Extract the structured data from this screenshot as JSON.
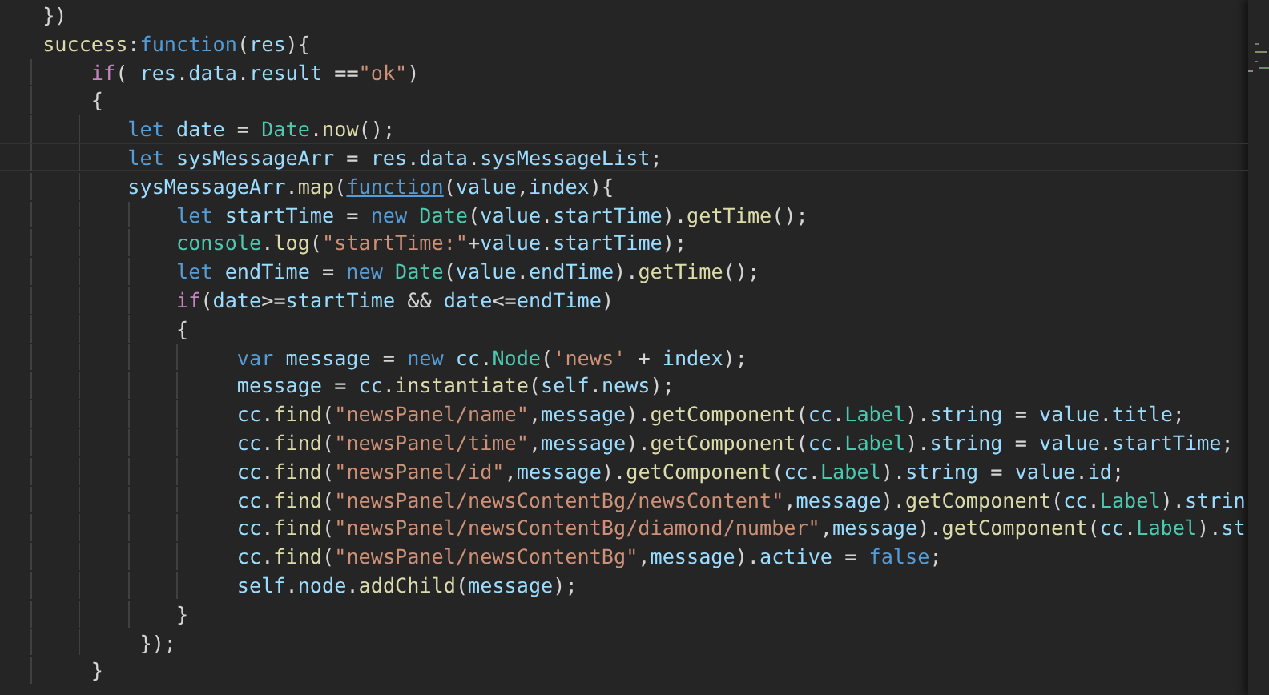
{
  "editor": {
    "lines": [
      {
        "current": false,
        "tokens": [
          {
            "t": "})",
            "kind": "p"
          }
        ]
      },
      {
        "current": false,
        "tokens": [
          {
            "t": "success",
            "kind": "fn"
          },
          {
            "t": ":",
            "kind": "p"
          },
          {
            "t": "function",
            "kind": "kw"
          },
          {
            "t": "(",
            "kind": "p"
          },
          {
            "t": "res",
            "kind": "v"
          },
          {
            "t": "){",
            "kind": "p"
          }
        ]
      },
      {
        "current": false,
        "tokens": [
          {
            "t": "    if",
            "kind": "ctl"
          },
          {
            "t": "( ",
            "kind": "p"
          },
          {
            "t": "res",
            "kind": "v"
          },
          {
            "t": ".",
            "kind": "p"
          },
          {
            "t": "data",
            "kind": "v"
          },
          {
            "t": ".",
            "kind": "p"
          },
          {
            "t": "result",
            "kind": "v"
          },
          {
            "t": " ==",
            "kind": "p"
          },
          {
            "t": "\"ok\"",
            "kind": "str"
          },
          {
            "t": ")",
            "kind": "p"
          }
        ]
      },
      {
        "current": false,
        "tokens": [
          {
            "t": "    {",
            "kind": "p"
          }
        ]
      },
      {
        "current": false,
        "tokens": [
          {
            "t": "       let ",
            "kind": "kw"
          },
          {
            "t": "date",
            "kind": "v"
          },
          {
            "t": " = ",
            "kind": "p"
          },
          {
            "t": "Date",
            "kind": "cls"
          },
          {
            "t": ".",
            "kind": "p"
          },
          {
            "t": "now",
            "kind": "fn"
          },
          {
            "t": "();",
            "kind": "p"
          }
        ]
      },
      {
        "current": true,
        "tokens": [
          {
            "t": "       let ",
            "kind": "kw"
          },
          {
            "t": "sysMessageArr",
            "kind": "v"
          },
          {
            "t": " = ",
            "kind": "p"
          },
          {
            "t": "res",
            "kind": "v"
          },
          {
            "t": ".",
            "kind": "p"
          },
          {
            "t": "data",
            "kind": "v"
          },
          {
            "t": ".",
            "kind": "p"
          },
          {
            "t": "sysMessageList",
            "kind": "v"
          },
          {
            "t": ";",
            "kind": "p"
          }
        ]
      },
      {
        "current": false,
        "tokens": [
          {
            "t": "       sysMessageArr",
            "kind": "v"
          },
          {
            "t": ".",
            "kind": "p"
          },
          {
            "t": "map",
            "kind": "fn"
          },
          {
            "t": "(",
            "kind": "p"
          },
          {
            "t": "function",
            "kind": "link"
          },
          {
            "t": "(",
            "kind": "p"
          },
          {
            "t": "value",
            "kind": "v"
          },
          {
            "t": ",",
            "kind": "p"
          },
          {
            "t": "index",
            "kind": "v"
          },
          {
            "t": "){",
            "kind": "p"
          }
        ]
      },
      {
        "current": false,
        "tokens": [
          {
            "t": "           let ",
            "kind": "kw"
          },
          {
            "t": "startTime",
            "kind": "v"
          },
          {
            "t": " = ",
            "kind": "p"
          },
          {
            "t": "new ",
            "kind": "kw"
          },
          {
            "t": "Date",
            "kind": "cls"
          },
          {
            "t": "(",
            "kind": "p"
          },
          {
            "t": "value",
            "kind": "v"
          },
          {
            "t": ".",
            "kind": "p"
          },
          {
            "t": "startTime",
            "kind": "v"
          },
          {
            "t": ").",
            "kind": "p"
          },
          {
            "t": "getTime",
            "kind": "fn"
          },
          {
            "t": "();",
            "kind": "p"
          }
        ]
      },
      {
        "current": false,
        "tokens": [
          {
            "t": "           console",
            "kind": "cls"
          },
          {
            "t": ".",
            "kind": "p"
          },
          {
            "t": "log",
            "kind": "fn"
          },
          {
            "t": "(",
            "kind": "p"
          },
          {
            "t": "\"startTime:\"",
            "kind": "str"
          },
          {
            "t": "+",
            "kind": "p"
          },
          {
            "t": "value",
            "kind": "v"
          },
          {
            "t": ".",
            "kind": "p"
          },
          {
            "t": "startTime",
            "kind": "v"
          },
          {
            "t": ");",
            "kind": "p"
          }
        ]
      },
      {
        "current": false,
        "tokens": [
          {
            "t": "           let ",
            "kind": "kw"
          },
          {
            "t": "endTime",
            "kind": "v"
          },
          {
            "t": " = ",
            "kind": "p"
          },
          {
            "t": "new ",
            "kind": "kw"
          },
          {
            "t": "Date",
            "kind": "cls"
          },
          {
            "t": "(",
            "kind": "p"
          },
          {
            "t": "value",
            "kind": "v"
          },
          {
            "t": ".",
            "kind": "p"
          },
          {
            "t": "endTime",
            "kind": "v"
          },
          {
            "t": ").",
            "kind": "p"
          },
          {
            "t": "getTime",
            "kind": "fn"
          },
          {
            "t": "();",
            "kind": "p"
          }
        ]
      },
      {
        "current": false,
        "tokens": [
          {
            "t": "           if",
            "kind": "ctl"
          },
          {
            "t": "(",
            "kind": "p"
          },
          {
            "t": "date",
            "kind": "v"
          },
          {
            "t": ">=",
            "kind": "p"
          },
          {
            "t": "startTime",
            "kind": "v"
          },
          {
            "t": " && ",
            "kind": "p"
          },
          {
            "t": "date",
            "kind": "v"
          },
          {
            "t": "<=",
            "kind": "p"
          },
          {
            "t": "endTime",
            "kind": "v"
          },
          {
            "t": ")",
            "kind": "p"
          }
        ]
      },
      {
        "current": false,
        "tokens": [
          {
            "t": "           {",
            "kind": "p"
          }
        ]
      },
      {
        "current": false,
        "tokens": [
          {
            "t": "                var ",
            "kind": "kw"
          },
          {
            "t": "message",
            "kind": "v"
          },
          {
            "t": " = ",
            "kind": "p"
          },
          {
            "t": "new ",
            "kind": "kw"
          },
          {
            "t": "cc",
            "kind": "v"
          },
          {
            "t": ".",
            "kind": "p"
          },
          {
            "t": "Node",
            "kind": "cls"
          },
          {
            "t": "(",
            "kind": "p"
          },
          {
            "t": "'news'",
            "kind": "str"
          },
          {
            "t": " + ",
            "kind": "p"
          },
          {
            "t": "index",
            "kind": "v"
          },
          {
            "t": ");",
            "kind": "p"
          }
        ]
      },
      {
        "current": false,
        "tokens": [
          {
            "t": "                message",
            "kind": "v"
          },
          {
            "t": " = ",
            "kind": "p"
          },
          {
            "t": "cc",
            "kind": "v"
          },
          {
            "t": ".",
            "kind": "p"
          },
          {
            "t": "instantiate",
            "kind": "fn"
          },
          {
            "t": "(",
            "kind": "p"
          },
          {
            "t": "self",
            "kind": "v"
          },
          {
            "t": ".",
            "kind": "p"
          },
          {
            "t": "news",
            "kind": "v"
          },
          {
            "t": ");",
            "kind": "p"
          }
        ]
      },
      {
        "current": false,
        "tokens": [
          {
            "t": "                cc",
            "kind": "v"
          },
          {
            "t": ".",
            "kind": "p"
          },
          {
            "t": "find",
            "kind": "fn"
          },
          {
            "t": "(",
            "kind": "p"
          },
          {
            "t": "\"newsPanel/name\"",
            "kind": "str"
          },
          {
            "t": ",",
            "kind": "p"
          },
          {
            "t": "message",
            "kind": "v"
          },
          {
            "t": ").",
            "kind": "p"
          },
          {
            "t": "getComponent",
            "kind": "fn"
          },
          {
            "t": "(",
            "kind": "p"
          },
          {
            "t": "cc",
            "kind": "v"
          },
          {
            "t": ".",
            "kind": "p"
          },
          {
            "t": "Label",
            "kind": "cls"
          },
          {
            "t": ").",
            "kind": "p"
          },
          {
            "t": "string",
            "kind": "v"
          },
          {
            "t": " = ",
            "kind": "p"
          },
          {
            "t": "value",
            "kind": "v"
          },
          {
            "t": ".",
            "kind": "p"
          },
          {
            "t": "title",
            "kind": "v"
          },
          {
            "t": ";",
            "kind": "p"
          }
        ]
      },
      {
        "current": false,
        "tokens": [
          {
            "t": "                cc",
            "kind": "v"
          },
          {
            "t": ".",
            "kind": "p"
          },
          {
            "t": "find",
            "kind": "fn"
          },
          {
            "t": "(",
            "kind": "p"
          },
          {
            "t": "\"newsPanel/time\"",
            "kind": "str"
          },
          {
            "t": ",",
            "kind": "p"
          },
          {
            "t": "message",
            "kind": "v"
          },
          {
            "t": ").",
            "kind": "p"
          },
          {
            "t": "getComponent",
            "kind": "fn"
          },
          {
            "t": "(",
            "kind": "p"
          },
          {
            "t": "cc",
            "kind": "v"
          },
          {
            "t": ".",
            "kind": "p"
          },
          {
            "t": "Label",
            "kind": "cls"
          },
          {
            "t": ").",
            "kind": "p"
          },
          {
            "t": "string",
            "kind": "v"
          },
          {
            "t": " = ",
            "kind": "p"
          },
          {
            "t": "value",
            "kind": "v"
          },
          {
            "t": ".",
            "kind": "p"
          },
          {
            "t": "startTime",
            "kind": "v"
          },
          {
            "t": ";",
            "kind": "p"
          }
        ]
      },
      {
        "current": false,
        "tokens": [
          {
            "t": "                cc",
            "kind": "v"
          },
          {
            "t": ".",
            "kind": "p"
          },
          {
            "t": "find",
            "kind": "fn"
          },
          {
            "t": "(",
            "kind": "p"
          },
          {
            "t": "\"newsPanel/id\"",
            "kind": "str"
          },
          {
            "t": ",",
            "kind": "p"
          },
          {
            "t": "message",
            "kind": "v"
          },
          {
            "t": ").",
            "kind": "p"
          },
          {
            "t": "getComponent",
            "kind": "fn"
          },
          {
            "t": "(",
            "kind": "p"
          },
          {
            "t": "cc",
            "kind": "v"
          },
          {
            "t": ".",
            "kind": "p"
          },
          {
            "t": "Label",
            "kind": "cls"
          },
          {
            "t": ").",
            "kind": "p"
          },
          {
            "t": "string",
            "kind": "v"
          },
          {
            "t": " = ",
            "kind": "p"
          },
          {
            "t": "value",
            "kind": "v"
          },
          {
            "t": ".",
            "kind": "p"
          },
          {
            "t": "id",
            "kind": "v"
          },
          {
            "t": ";",
            "kind": "p"
          }
        ]
      },
      {
        "current": false,
        "tokens": [
          {
            "t": "                cc",
            "kind": "v"
          },
          {
            "t": ".",
            "kind": "p"
          },
          {
            "t": "find",
            "kind": "fn"
          },
          {
            "t": "(",
            "kind": "p"
          },
          {
            "t": "\"newsPanel/newsContentBg/newsContent\"",
            "kind": "str"
          },
          {
            "t": ",",
            "kind": "p"
          },
          {
            "t": "message",
            "kind": "v"
          },
          {
            "t": ").",
            "kind": "p"
          },
          {
            "t": "getComponent",
            "kind": "fn"
          },
          {
            "t": "(",
            "kind": "p"
          },
          {
            "t": "cc",
            "kind": "v"
          },
          {
            "t": ".",
            "kind": "p"
          },
          {
            "t": "Label",
            "kind": "cls"
          },
          {
            "t": ").",
            "kind": "p"
          },
          {
            "t": "strin",
            "kind": "v"
          }
        ]
      },
      {
        "current": false,
        "tokens": [
          {
            "t": "                cc",
            "kind": "v"
          },
          {
            "t": ".",
            "kind": "p"
          },
          {
            "t": "find",
            "kind": "fn"
          },
          {
            "t": "(",
            "kind": "p"
          },
          {
            "t": "\"newsPanel/newsContentBg/diamond/number\"",
            "kind": "str"
          },
          {
            "t": ",",
            "kind": "p"
          },
          {
            "t": "message",
            "kind": "v"
          },
          {
            "t": ").",
            "kind": "p"
          },
          {
            "t": "getComponent",
            "kind": "fn"
          },
          {
            "t": "(",
            "kind": "p"
          },
          {
            "t": "cc",
            "kind": "v"
          },
          {
            "t": ".",
            "kind": "p"
          },
          {
            "t": "Label",
            "kind": "cls"
          },
          {
            "t": ").",
            "kind": "p"
          },
          {
            "t": "st",
            "kind": "v"
          }
        ]
      },
      {
        "current": false,
        "tokens": [
          {
            "t": "                cc",
            "kind": "v"
          },
          {
            "t": ".",
            "kind": "p"
          },
          {
            "t": "find",
            "kind": "fn"
          },
          {
            "t": "(",
            "kind": "p"
          },
          {
            "t": "\"newsPanel/newsContentBg\"",
            "kind": "str"
          },
          {
            "t": ",",
            "kind": "p"
          },
          {
            "t": "message",
            "kind": "v"
          },
          {
            "t": ").",
            "kind": "p"
          },
          {
            "t": "active",
            "kind": "v"
          },
          {
            "t": " = ",
            "kind": "p"
          },
          {
            "t": "false",
            "kind": "kw"
          },
          {
            "t": ";",
            "kind": "p"
          }
        ]
      },
      {
        "current": false,
        "tokens": [
          {
            "t": "                self",
            "kind": "v"
          },
          {
            "t": ".",
            "kind": "p"
          },
          {
            "t": "node",
            "kind": "v"
          },
          {
            "t": ".",
            "kind": "p"
          },
          {
            "t": "addChild",
            "kind": "fn"
          },
          {
            "t": "(",
            "kind": "p"
          },
          {
            "t": "message",
            "kind": "v"
          },
          {
            "t": ");",
            "kind": "p"
          }
        ]
      },
      {
        "current": false,
        "tokens": [
          {
            "t": "           }",
            "kind": "p"
          }
        ]
      },
      {
        "current": false,
        "tokens": [
          {
            "t": "        });",
            "kind": "p"
          }
        ]
      },
      {
        "current": false,
        "tokens": [
          {
            "t": "    }",
            "kind": "p"
          }
        ]
      }
    ]
  }
}
